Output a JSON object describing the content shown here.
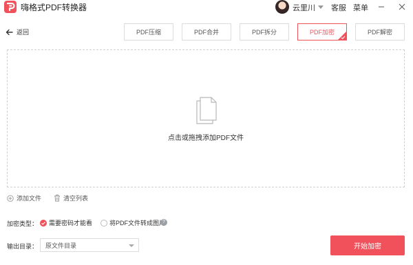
{
  "app": {
    "title": "嗨格式PDF转换器",
    "brand_color": "#f0515a"
  },
  "header": {
    "user_name": "云里川",
    "service_label": "客服",
    "menu_label": "菜单",
    "minimize_icon": "minimize-icon",
    "close_icon": "close-icon"
  },
  "nav": {
    "back_label": "返回",
    "tabs": [
      {
        "label": "PDF压缩",
        "active": false
      },
      {
        "label": "PDF合并",
        "active": false
      },
      {
        "label": "PDF拆分",
        "active": false
      },
      {
        "label": "PDF加密",
        "active": true
      },
      {
        "label": "PDF解密",
        "active": false
      }
    ]
  },
  "drop_zone": {
    "text": "点击或拖拽添加PDF文件",
    "icon": "document-icon"
  },
  "list_actions": {
    "add_file": "添加文件",
    "clear_list": "清空列表"
  },
  "options": {
    "encrypt_type_label": "加密类型：",
    "options": [
      {
        "label": "需要密码才能看",
        "checked": true
      },
      {
        "label": "将PDF文件转成图片",
        "checked": false
      }
    ],
    "output_dir_label": "输出目录：",
    "output_dir_value": "原文件目录"
  },
  "actions": {
    "start_label": "开始加密"
  }
}
